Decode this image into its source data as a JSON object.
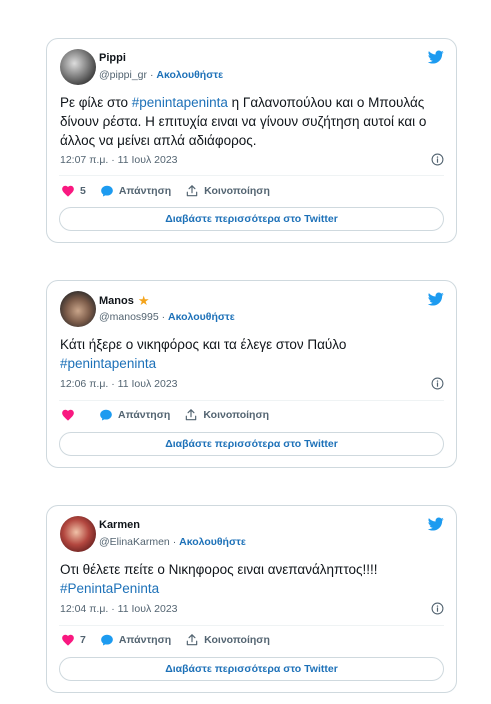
{
  "tweets": [
    {
      "name": "Pippi",
      "handle": "@pippi_gr",
      "separator": "·",
      "follow_label": "Ακολουθήστε",
      "text_before": "Ρε φίλε στο ",
      "hashtag": "#penintapeninta",
      "text_after": " η Γαλανοπούλου και ο Μπουλάς δίνουν ρέστα. Η επιτυχία ειναι να γίνουν συζήτηση αυτοί και ο άλλος να μείνει απλά αδιάφορος.",
      "timestamp": "12:07 π.μ. · 11 Ιουλ 2023",
      "likes": "5",
      "reply_label": "Απάντηση",
      "share_label": "Κοινοποίηση",
      "read_more": "Διαβάστε περισσότερα στο Twitter"
    },
    {
      "name": "Manos",
      "badge": "★",
      "handle": "@manos995",
      "separator": "·",
      "follow_label": "Ακολουθήστε",
      "text_before": "Κάτι ήξερε ο νικηφόρος και τα έλεγε στον Παύλο",
      "hashtag": "#penintapeninta",
      "text_after": "",
      "timestamp": "12:06 π.μ. · 11 Ιουλ 2023",
      "likes": "",
      "reply_label": "Απάντηση",
      "share_label": "Κοινοποίηση",
      "read_more": "Διαβάστε περισσότερα στο Twitter"
    },
    {
      "name": "Karmen",
      "handle": "@ElinaKarmen",
      "separator": "·",
      "follow_label": "Ακολουθήστε",
      "text_before": "Οτι θέλετε πείτε ο Νικηφορος ειναι ανεπανάληπτος!!!!",
      "hashtag": "#PenintaPeninta",
      "text_after": "",
      "timestamp": "12:04 π.μ. · 11 Ιουλ 2023",
      "likes": "7",
      "reply_label": "Απάντηση",
      "share_label": "Κοινοποίηση",
      "read_more": "Διαβάστε περισσότερα στο Twitter"
    }
  ],
  "colors": {
    "accent": "#1d9bf0",
    "link": "#1d71b8",
    "heart": "#f91880",
    "muted": "#536471",
    "border": "#cfd9de"
  },
  "icons": {
    "brand": "twitter-bird-icon",
    "like": "heart-icon",
    "reply": "speech-bubble-icon",
    "share": "share-upload-icon",
    "info": "info-icon",
    "badge": "star-icon"
  }
}
